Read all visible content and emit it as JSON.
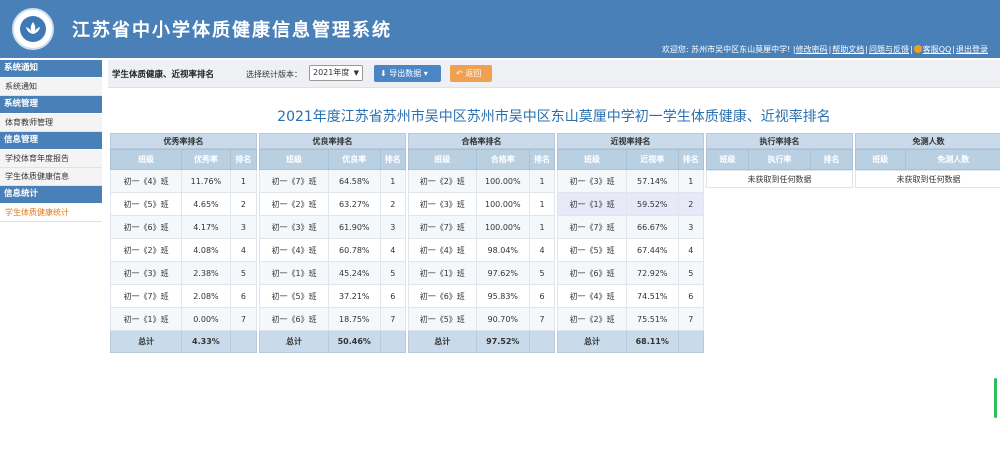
{
  "header": {
    "title": "江苏省中小学体质健康信息管理系统",
    "welcome": "欢迎您: 苏州市吴中区东山莫厘中学! ",
    "links": [
      "修改密码",
      "帮助文档",
      "问题与反馈",
      "客服QQ",
      "退出登录"
    ]
  },
  "sidebar": {
    "groups": [
      {
        "label": "系统通知",
        "items": [
          "系统通知"
        ]
      },
      {
        "label": "系统管理",
        "items": [
          "体育教师管理"
        ]
      },
      {
        "label": "信息管理",
        "items": [
          "学校体育年度报告",
          "学生体质健康信息"
        ]
      },
      {
        "label": "信息统计",
        "items": [
          "学生体质健康统计"
        ]
      }
    ]
  },
  "toolbar": {
    "title": "学生体质健康、近视率排名",
    "version_label": "选择统计版本：",
    "version_value": "2021年度",
    "export_label": "导出数据",
    "back_label": "返回"
  },
  "report_title": "2021年度江苏省苏州市吴中区苏州市吴中区东山莫厘中学初一学生体质健康、近视率排名",
  "colors": {
    "header": "#4a80b8",
    "accent_text": "#2a70b0",
    "export_btn": "#4a86c6",
    "back_btn": "#f0a050"
  },
  "panels": [
    {
      "title": "优秀率排名",
      "columns": [
        "班级",
        "优秀率",
        "排名"
      ],
      "rows": [
        [
          "初一《4》班",
          "11.76%",
          "1"
        ],
        [
          "初一《5》班",
          "4.65%",
          "2"
        ],
        [
          "初一《6》班",
          "4.17%",
          "3"
        ],
        [
          "初一《2》班",
          "4.08%",
          "4"
        ],
        [
          "初一《3》班",
          "2.38%",
          "5"
        ],
        [
          "初一《7》班",
          "2.08%",
          "6"
        ],
        [
          "初一《1》班",
          "0.00%",
          "7"
        ]
      ],
      "total": [
        "总计",
        "4.33%"
      ]
    },
    {
      "title": "优良率排名",
      "columns": [
        "班级",
        "优良率",
        "排名"
      ],
      "rows": [
        [
          "初一《7》班",
          "64.58%",
          "1"
        ],
        [
          "初一《2》班",
          "63.27%",
          "2"
        ],
        [
          "初一《3》班",
          "61.90%",
          "3"
        ],
        [
          "初一《4》班",
          "60.78%",
          "4"
        ],
        [
          "初一《1》班",
          "45.24%",
          "5"
        ],
        [
          "初一《5》班",
          "37.21%",
          "6"
        ],
        [
          "初一《6》班",
          "18.75%",
          "7"
        ]
      ],
      "total": [
        "总计",
        "50.46%"
      ]
    },
    {
      "title": "合格率排名",
      "columns": [
        "班级",
        "合格率",
        "排名"
      ],
      "rows": [
        [
          "初一《2》班",
          "100.00%",
          "1"
        ],
        [
          "初一《3》班",
          "100.00%",
          "1"
        ],
        [
          "初一《7》班",
          "100.00%",
          "1"
        ],
        [
          "初一《4》班",
          "98.04%",
          "4"
        ],
        [
          "初一《1》班",
          "97.62%",
          "5"
        ],
        [
          "初一《6》班",
          "95.83%",
          "6"
        ],
        [
          "初一《5》班",
          "90.70%",
          "7"
        ]
      ],
      "total": [
        "总计",
        "97.52%"
      ]
    },
    {
      "title": "近视率排名",
      "columns": [
        "班级",
        "近视率",
        "排名"
      ],
      "rows": [
        [
          "初一《3》班",
          "57.14%",
          "1"
        ],
        [
          "初一《1》班",
          "59.52%",
          "2"
        ],
        [
          "初一《7》班",
          "66.67%",
          "3"
        ],
        [
          "初一《5》班",
          "67.44%",
          "4"
        ],
        [
          "初一《6》班",
          "72.92%",
          "5"
        ],
        [
          "初一《4》班",
          "74.51%",
          "6"
        ],
        [
          "初一《2》班",
          "75.51%",
          "7"
        ]
      ],
      "total": [
        "总计",
        "68.11%"
      ]
    },
    {
      "title": "执行率排名",
      "columns": [
        "班级",
        "执行率",
        "排名"
      ],
      "empty": "未获取到任何数据"
    },
    {
      "title": "免测人数",
      "columns": [
        "班级",
        "免测人数"
      ],
      "empty": "未获取到任何数据"
    }
  ]
}
